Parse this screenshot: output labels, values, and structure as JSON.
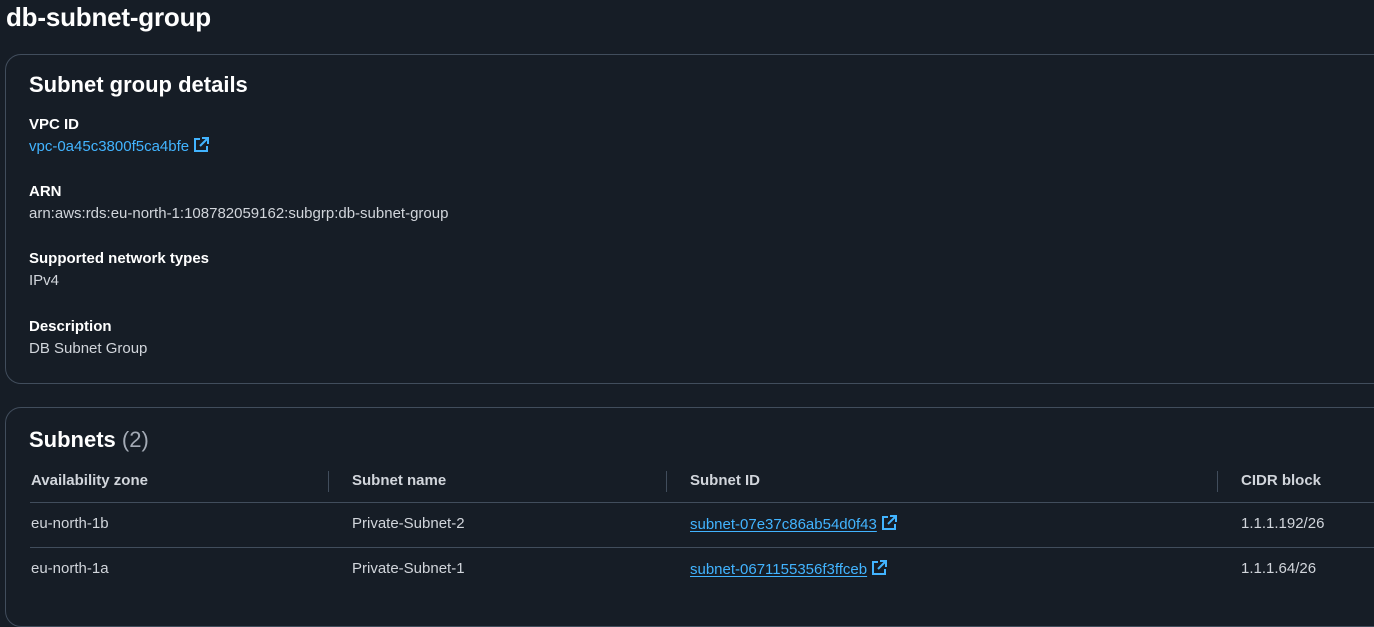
{
  "page": {
    "title": "db-subnet-group"
  },
  "details": {
    "title": "Subnet group details",
    "vpc_id_label": "VPC ID",
    "vpc_id_value": "vpc-0a45c3800f5ca4bfe",
    "arn_label": "ARN",
    "arn_value": "arn:aws:rds:eu-north-1:108782059162:subgrp:db-subnet-group",
    "network_types_label": "Supported network types",
    "network_types_value": "IPv4",
    "description_label": "Description",
    "description_value": "DB Subnet Group"
  },
  "subnets": {
    "title": "Subnets",
    "count": "(2)",
    "columns": [
      "Availability zone",
      "Subnet name",
      "Subnet ID",
      "CIDR block"
    ],
    "rows": [
      {
        "az": "eu-north-1b",
        "name": "Private-Subnet-2",
        "subnet_id": "subnet-07e37c86ab54d0f43",
        "cidr": "1.1.1.192/26"
      },
      {
        "az": "eu-north-1a",
        "name": "Private-Subnet-1",
        "subnet_id": "subnet-0671155356f3ffceb",
        "cidr": "1.1.1.64/26"
      }
    ]
  },
  "icons": {
    "external_link": "external-link-icon"
  },
  "colors": {
    "background": "#161d26",
    "border": "#414d5c",
    "link": "#42b4ff",
    "heading": "#ffffff",
    "text": "#d1d5db"
  }
}
